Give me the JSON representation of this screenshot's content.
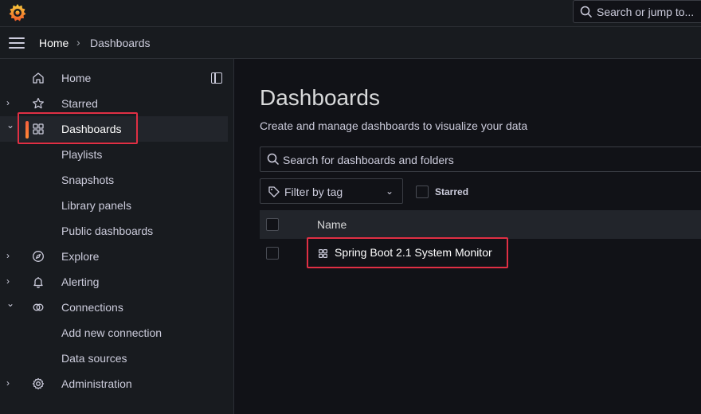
{
  "topbar": {
    "search_placeholder": "Search or jump to..."
  },
  "breadcrumb": {
    "home": "Home",
    "separator": "›",
    "current": "Dashboards"
  },
  "sidebar": {
    "items": [
      {
        "label": "Home",
        "icon": "home-icon",
        "chevron": ""
      },
      {
        "label": "Starred",
        "icon": "star-icon",
        "chevron": "›"
      },
      {
        "label": "Dashboards",
        "icon": "apps-icon",
        "chevron": "⌄"
      },
      {
        "label": "Playlists"
      },
      {
        "label": "Snapshots"
      },
      {
        "label": "Library panels"
      },
      {
        "label": "Public dashboards"
      },
      {
        "label": "Explore",
        "icon": "compass-icon",
        "chevron": "›"
      },
      {
        "label": "Alerting",
        "icon": "bell-icon",
        "chevron": "›"
      },
      {
        "label": "Connections",
        "icon": "connections-icon",
        "chevron": "⌄"
      },
      {
        "label": "Add new connection"
      },
      {
        "label": "Data sources"
      },
      {
        "label": "Administration",
        "icon": "gear-icon",
        "chevron": "›"
      }
    ]
  },
  "main": {
    "title": "Dashboards",
    "subtitle": "Create and manage dashboards to visualize your data",
    "search_placeholder": "Search for dashboards and folders",
    "filter_placeholder": "Filter by tag",
    "starred_label": "Starred",
    "table": {
      "header_name": "Name",
      "rows": [
        {
          "name": "Spring Boot 2.1 System Monitor"
        }
      ]
    }
  },
  "colors": {
    "background": "#111217",
    "panel": "#181b1f",
    "accent": "#ff8833",
    "highlight_box": "#e02f44"
  }
}
